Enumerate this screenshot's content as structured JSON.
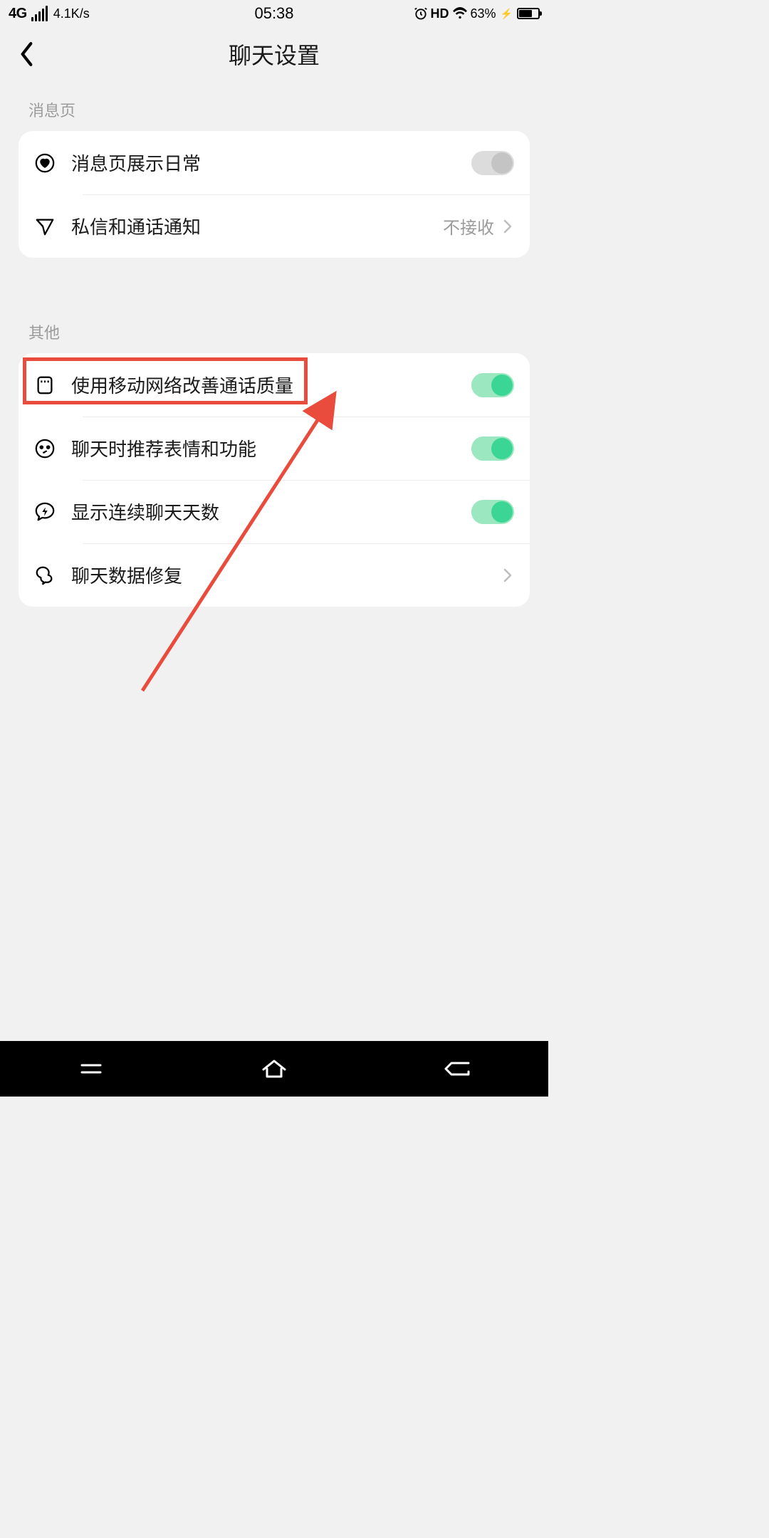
{
  "status_bar": {
    "network_type": "4G",
    "net_speed": "4.1K/s",
    "time": "05:38",
    "hd": "HD",
    "battery_pct": "63%"
  },
  "header": {
    "title": "聊天设置"
  },
  "sections": [
    {
      "label": "消息页",
      "rows": [
        {
          "icon": "heart-circle-icon",
          "label": "消息页展示日常",
          "type": "switch",
          "on": false
        },
        {
          "icon": "send-icon",
          "label": "私信和通话通知",
          "type": "nav",
          "value": "不接收"
        }
      ]
    },
    {
      "label": "其他",
      "rows": [
        {
          "icon": "sim-card-icon",
          "label": "使用移动网络改善通话质量",
          "type": "switch",
          "on": true
        },
        {
          "icon": "face-icon",
          "label": "聊天时推荐表情和功能",
          "type": "switch",
          "on": true
        },
        {
          "icon": "bolt-bubble-icon",
          "label": "显示连续聊天天数",
          "type": "switch",
          "on": true
        },
        {
          "icon": "chat-repair-icon",
          "label": "聊天数据修复",
          "type": "nav"
        }
      ]
    }
  ],
  "annotation": {
    "highlight_row_label": "聊天时推荐表情和功能",
    "color": "#e94b3c"
  }
}
